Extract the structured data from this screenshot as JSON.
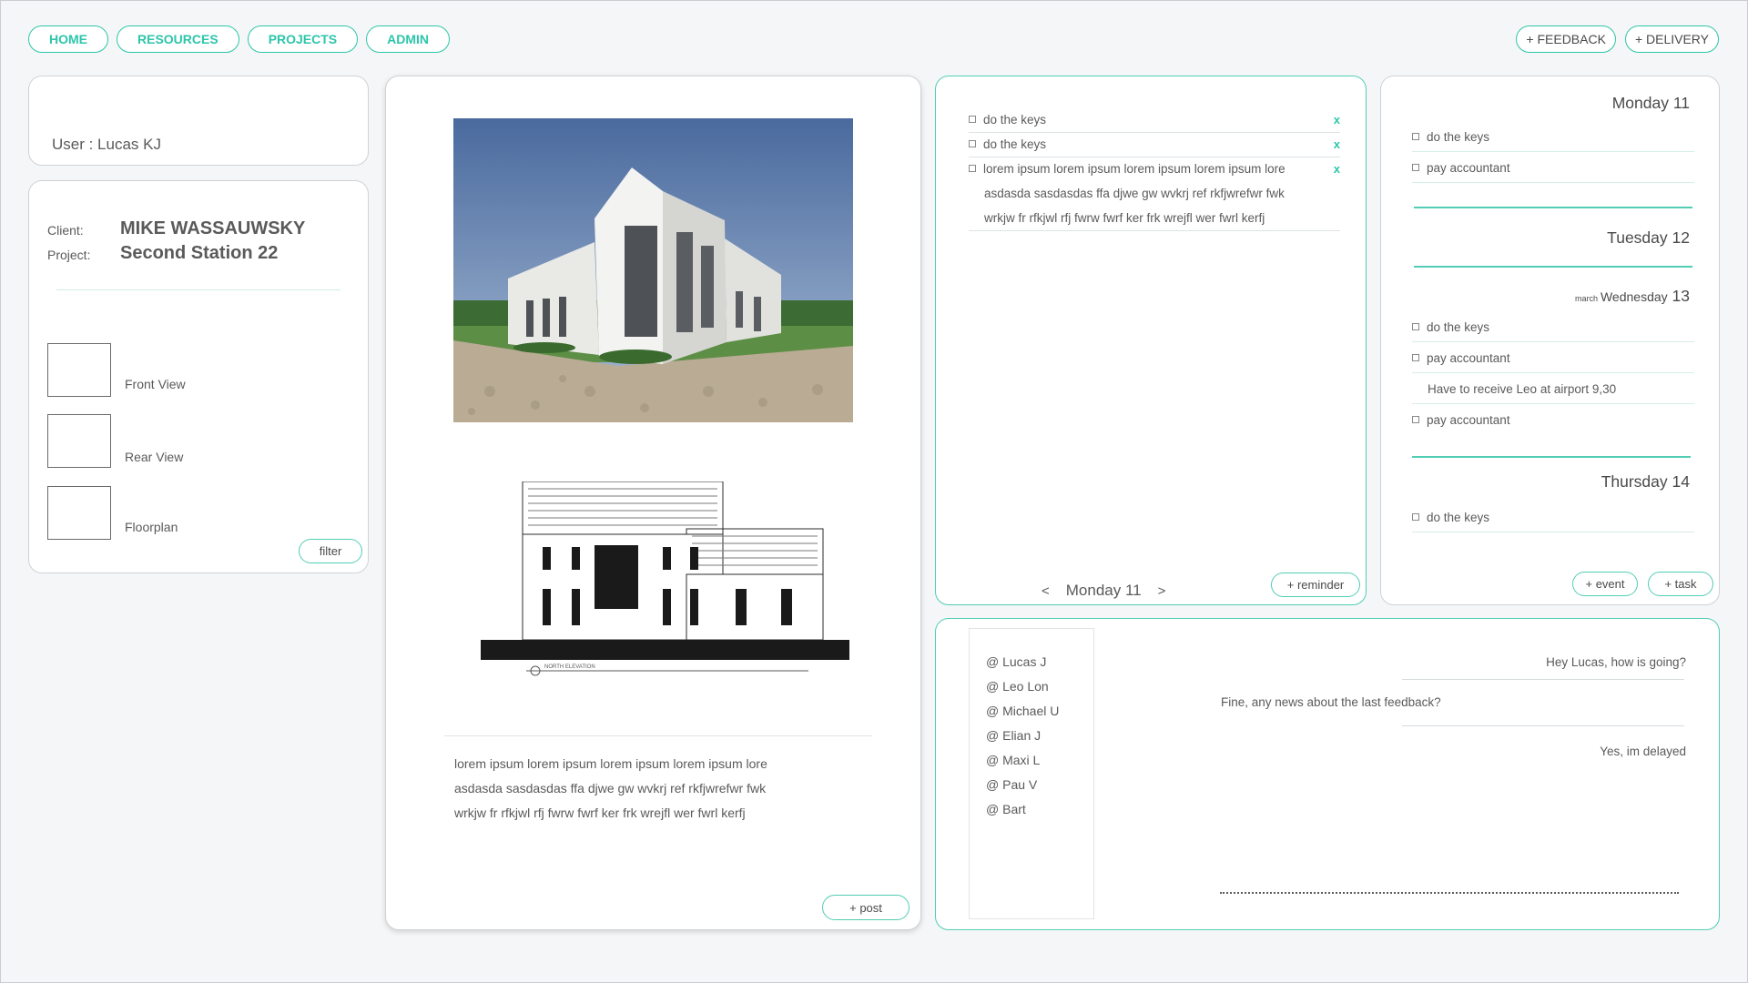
{
  "nav": {
    "home": "HOME",
    "resources": "RESOURCES",
    "projects": "PROJECTS",
    "admin": "ADMIN"
  },
  "actions": {
    "feedback": "+ FEEDBACK",
    "delivery": "+ DELIVERY"
  },
  "user": {
    "label": "User : Lucas KJ"
  },
  "client": {
    "client_label": "Client:",
    "client_name": "MIKE WASSAUWSKY",
    "project_label": "Project:",
    "project_name": "Second Station 22",
    "views": [
      "Front View",
      "Rear View",
      "Floorplan"
    ],
    "filter_label": "filter"
  },
  "post": {
    "text_lines": [
      "lorem ipsum lorem ipsum lorem ipsum lorem ipsum lore",
      "asdasda sasdasdas ffa djwe gw wvkrj ref rkfjwrefwr fwk",
      "wrkjw fr rfkjwl rfj fwrw fwrf ker frk wrejfl wer  fwrl kerfj"
    ],
    "post_label": "+ post",
    "drawing_caption": "NORTH ELEVATION"
  },
  "reminders": {
    "items": [
      {
        "text": "do the keys",
        "remove": "x"
      },
      {
        "text": "do the keys",
        "remove": "x"
      },
      {
        "text": "lorem ipsum lorem ipsum lorem ipsum lorem ipsum lore",
        "remove": "x"
      }
    ],
    "continuation": [
      "asdasda sasdasdas ffa djwe gw wvkrj ref rkfjwrefwr fwk",
      "wrkjw fr rfkjwl rfj fwrw fwrf ker frk wrejfl wer  fwrl kerfj"
    ],
    "prev": "<",
    "current_day": "Monday 11",
    "next": ">",
    "add_label": "+ reminder"
  },
  "calendar": {
    "days": [
      {
        "name": "Monday",
        "num": "11",
        "items": [
          "do the keys",
          "pay accountant"
        ]
      },
      {
        "name": "Tuesday",
        "num": "12",
        "items": []
      },
      {
        "month": "march",
        "name": "Wednesday",
        "num": "13",
        "items": [
          "do the keys",
          "pay accountant",
          "Have to receive Leo at airport 9,30",
          "pay accountant"
        ]
      },
      {
        "name": "Thursday",
        "num": "14",
        "items": [
          "do the keys"
        ]
      }
    ],
    "event_label": "+ event",
    "task_label": "+ task"
  },
  "chat": {
    "contacts": [
      "@ Lucas J",
      "@ Leo Lon",
      "@ Michael U",
      "@ Elian J",
      "@ Maxi L",
      "@ Pau V",
      "@ Bart"
    ],
    "messages": [
      {
        "text": "Hey Lucas, how is going?",
        "side": "right"
      },
      {
        "text": "Fine, any news about the last feedback?",
        "side": "left"
      },
      {
        "text": "Yes, im delayed",
        "side": "right"
      }
    ]
  }
}
